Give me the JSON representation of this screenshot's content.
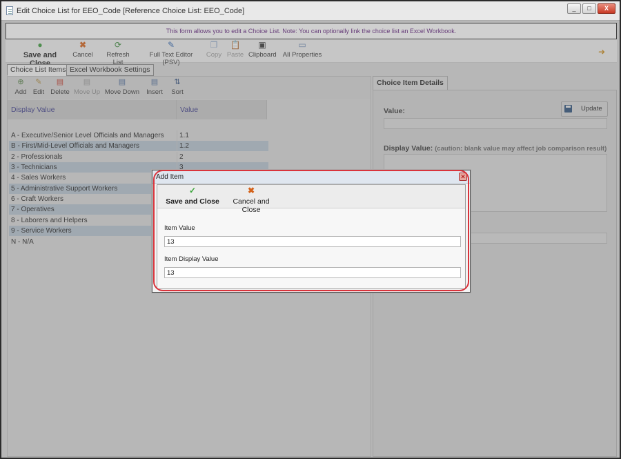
{
  "window": {
    "title": "Edit Choice List for EEO_Code [Reference Choice List: EEO_Code]",
    "controls": [
      "_",
      "□",
      "X"
    ]
  },
  "banner": "This form allows you to edit a Choice List.  Note: You can optionally link the choice list an Excel Workbook.",
  "toolbar": {
    "save_close": "Save and Close",
    "cancel": "Cancel",
    "refresh": "Refresh List",
    "full_text_editor": "Full Text Editor (PSV)",
    "copy": "Copy",
    "paste": "Paste",
    "clipboard": "Clipboard",
    "all_properties": "All Properties"
  },
  "tabs": {
    "choice_list_items": "Choice List Items",
    "excel_workbook_settings": "Excel Workbook Settings"
  },
  "list_toolbar": {
    "add": "Add",
    "edit": "Edit",
    "delete": "Delete",
    "move_up": "Move Up",
    "move_down": "Move Down",
    "insert": "Insert",
    "sort": "Sort"
  },
  "grid": {
    "columns": [
      "Display Value",
      "Value"
    ],
    "rows": [
      {
        "display": "A - Executive/Senior Level Officials and Managers",
        "value": "1.1"
      },
      {
        "display": "B - First/Mid-Level Officials and Managers",
        "value": "1.2"
      },
      {
        "display": "2 - Professionals",
        "value": "2"
      },
      {
        "display": "3 - Technicians",
        "value": "3"
      },
      {
        "display": "4 - Sales Workers",
        "value": ""
      },
      {
        "display": "5 - Administrative Support Workers",
        "value": ""
      },
      {
        "display": "6 - Craft Workers",
        "value": ""
      },
      {
        "display": "7 - Operatives",
        "value": ""
      },
      {
        "display": "8 - Laborers and Helpers",
        "value": ""
      },
      {
        "display": "9 - Service Workers",
        "value": ""
      },
      {
        "display": "N - N/A",
        "value": ""
      }
    ]
  },
  "details": {
    "tab": "Choice Item Details",
    "value_label": "Value:",
    "update": "Update",
    "display_value_label": "Display Value:",
    "display_value_note": "(caution: blank value may affect job comparison result)"
  },
  "dialog": {
    "title": "Add Item",
    "save_close": "Save and Close",
    "cancel_close": "Cancel and Close",
    "item_value_label": "Item Value",
    "item_value": "13",
    "item_display_label": "Item Display Value",
    "item_display_value": "13"
  }
}
